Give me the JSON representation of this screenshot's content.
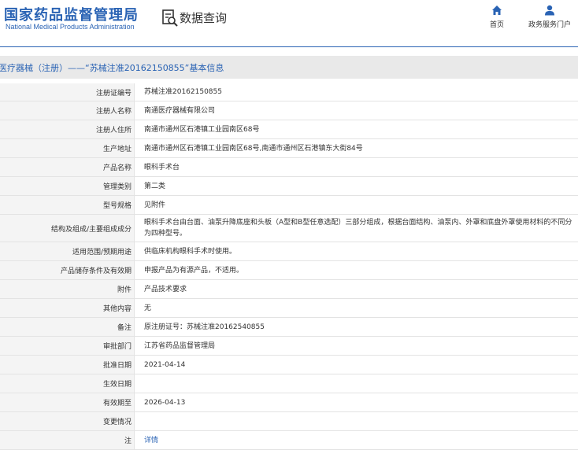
{
  "header": {
    "logo_cn": "国家药品监督管理局",
    "logo_en": "National Medical Products Administration",
    "section_label": "数据查询",
    "nav": [
      {
        "label": "首页",
        "icon": "home-icon"
      },
      {
        "label": "政务服务门户",
        "icon": "user-icon"
      }
    ]
  },
  "title": "医疗器械（注册）——“苏械注准20162150855”基本信息",
  "rows": [
    {
      "label": "注册证编号",
      "value": "苏械注准20162150855"
    },
    {
      "label": "注册人名称",
      "value": "南通医疗器械有限公司"
    },
    {
      "label": "注册人住所",
      "value": "南通市通州区石港镇工业园南区68号"
    },
    {
      "label": "生产地址",
      "value": "南通市通州区石港镇工业园南区68号,南通市通州区石港镇东大街84号"
    },
    {
      "label": "产品名称",
      "value": "眼科手术台"
    },
    {
      "label": "管理类别",
      "value": "第二类"
    },
    {
      "label": "型号规格",
      "value": "见附件"
    },
    {
      "label": "结构及组成/主要组成成分",
      "value": "眼科手术台由台面、油泵升降底座和头板（A型和B型任意选配）三部分组成，根据台面结构、油泵内、外罩和底盘外罩使用材料的不同分为四种型号。"
    },
    {
      "label": "适用范围/预期用途",
      "value": "供临床机构眼科手术时使用。"
    },
    {
      "label": "产品储存条件及有效期",
      "value": "申报产品为有源产品，不适用。"
    },
    {
      "label": "附件",
      "value": "产品技术要求"
    },
    {
      "label": "其他内容",
      "value": "无"
    },
    {
      "label": "备注",
      "value": "原注册证号：苏械注准20162540855"
    },
    {
      "label": "审批部门",
      "value": "江苏省药品监督管理局"
    },
    {
      "label": "批准日期",
      "value": "2021-04-14"
    },
    {
      "label": "生效日期",
      "value": ""
    },
    {
      "label": "有效期至",
      "value": "2026-04-13"
    },
    {
      "label": "变更情况",
      "value": ""
    },
    {
      "label": "注",
      "value": "详情",
      "is_link": true
    }
  ],
  "colors": {
    "brand": "#2a63b4",
    "label_bg": "#f4f4f4",
    "title_bg": "#e9e9e9"
  }
}
